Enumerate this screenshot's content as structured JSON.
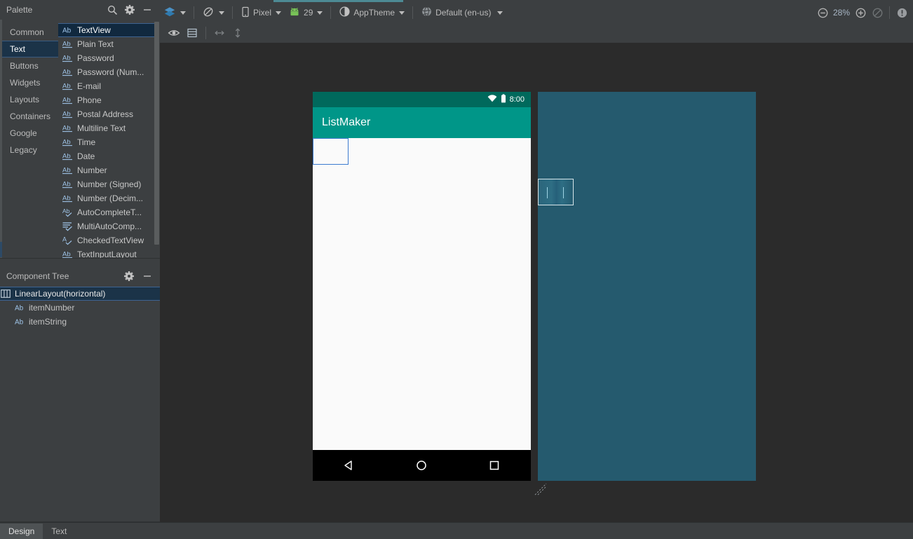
{
  "palette": {
    "title": "Palette",
    "header_icons": [
      "search-icon",
      "gear-icon",
      "minimize-icon"
    ],
    "groups": [
      {
        "label": "Common",
        "selected": false
      },
      {
        "label": "Text",
        "selected": true
      },
      {
        "label": "Buttons",
        "selected": false
      },
      {
        "label": "Widgets",
        "selected": false
      },
      {
        "label": "Layouts",
        "selected": false
      },
      {
        "label": "Containers",
        "selected": false
      },
      {
        "label": "Google",
        "selected": false
      },
      {
        "label": "Legacy",
        "selected": false
      }
    ],
    "items": [
      {
        "label": "TextView",
        "icon": "ab-icon",
        "selected": true
      },
      {
        "label": "Plain Text",
        "icon": "ab-underline-icon",
        "selected": false
      },
      {
        "label": "Password",
        "icon": "ab-underline-icon",
        "selected": false
      },
      {
        "label": "Password (Num...",
        "icon": "ab-underline-icon",
        "selected": false
      },
      {
        "label": "E-mail",
        "icon": "ab-underline-icon",
        "selected": false
      },
      {
        "label": "Phone",
        "icon": "ab-underline-icon",
        "selected": false
      },
      {
        "label": "Postal Address",
        "icon": "ab-underline-icon",
        "selected": false
      },
      {
        "label": "Multiline Text",
        "icon": "ab-underline-icon",
        "selected": false
      },
      {
        "label": "Time",
        "icon": "ab-underline-icon",
        "selected": false
      },
      {
        "label": "Date",
        "icon": "ab-underline-icon",
        "selected": false
      },
      {
        "label": "Number",
        "icon": "ab-underline-icon",
        "selected": false
      },
      {
        "label": "Number (Signed)",
        "icon": "ab-underline-icon",
        "selected": false
      },
      {
        "label": "Number (Decim...",
        "icon": "ab-underline-icon",
        "selected": false
      },
      {
        "label": "AutoCompleteT...",
        "icon": "ab-check-icon",
        "selected": false
      },
      {
        "label": "MultiAutoComp...",
        "icon": "lines-check-icon",
        "selected": false
      },
      {
        "label": "CheckedTextView",
        "icon": "a-check-icon",
        "selected": false
      },
      {
        "label": "TextInputLayout",
        "icon": "ab-underline-icon",
        "selected": false
      }
    ]
  },
  "component_tree": {
    "title": "Component Tree",
    "header_icons": [
      "gear-icon",
      "minimize-icon"
    ],
    "nodes": [
      {
        "label": "LinearLayout(horizontal)",
        "icon": "linearlayout-icon",
        "depth": 0,
        "selected": true
      },
      {
        "label": "itemNumber",
        "icon": "ab-icon",
        "depth": 1,
        "selected": false
      },
      {
        "label": "itemString",
        "icon": "ab-icon",
        "depth": 1,
        "selected": false
      }
    ]
  },
  "toolbar": {
    "design_mode_label": "",
    "orientation_label": "",
    "device_label": "Pixel",
    "api_label": "29",
    "theme_label": "AppTheme",
    "locale_label": "Default (en-us)",
    "zoom_percent": "28%",
    "icons": {
      "layers": "layers-icon",
      "rotate": "orientation-icon",
      "device": "phone-icon",
      "api": "android-icon",
      "theme": "theme-icon",
      "locale": "globe-icon",
      "zoom_out": "zoom-out-icon",
      "zoom_in": "zoom-in-icon",
      "zoom_fit": "zoom-fit-icon",
      "issues": "issues-icon"
    }
  },
  "toolbar_second": {
    "icons": {
      "eye": "eye-icon",
      "rows": "table-rows-icon",
      "horizontal": "arrows-horizontal-icon",
      "vertical": "arrows-vertical-icon"
    }
  },
  "device_preview": {
    "status_bar": {
      "clock": "8:00",
      "icons": [
        "wifi-icon",
        "battery-icon"
      ]
    },
    "app_bar_title": "ListMaker",
    "nav_bar": {
      "back": "nav-back-icon",
      "home": "nav-home-icon",
      "recents": "nav-recents-icon"
    },
    "colors": {
      "status_bar": "#00695c",
      "app_bar": "#009688",
      "content": "#fafafa",
      "nav_bar": "#000000",
      "selection": "#3c7bd0"
    }
  },
  "blueprint": {
    "background_color": "#255a6e",
    "selection_border": "#d8e6ea"
  },
  "bottom_tabs": [
    {
      "label": "Design",
      "active": true
    },
    {
      "label": "Text",
      "active": false
    }
  ],
  "canvas": {
    "background_color": "#2b2b2b"
  }
}
